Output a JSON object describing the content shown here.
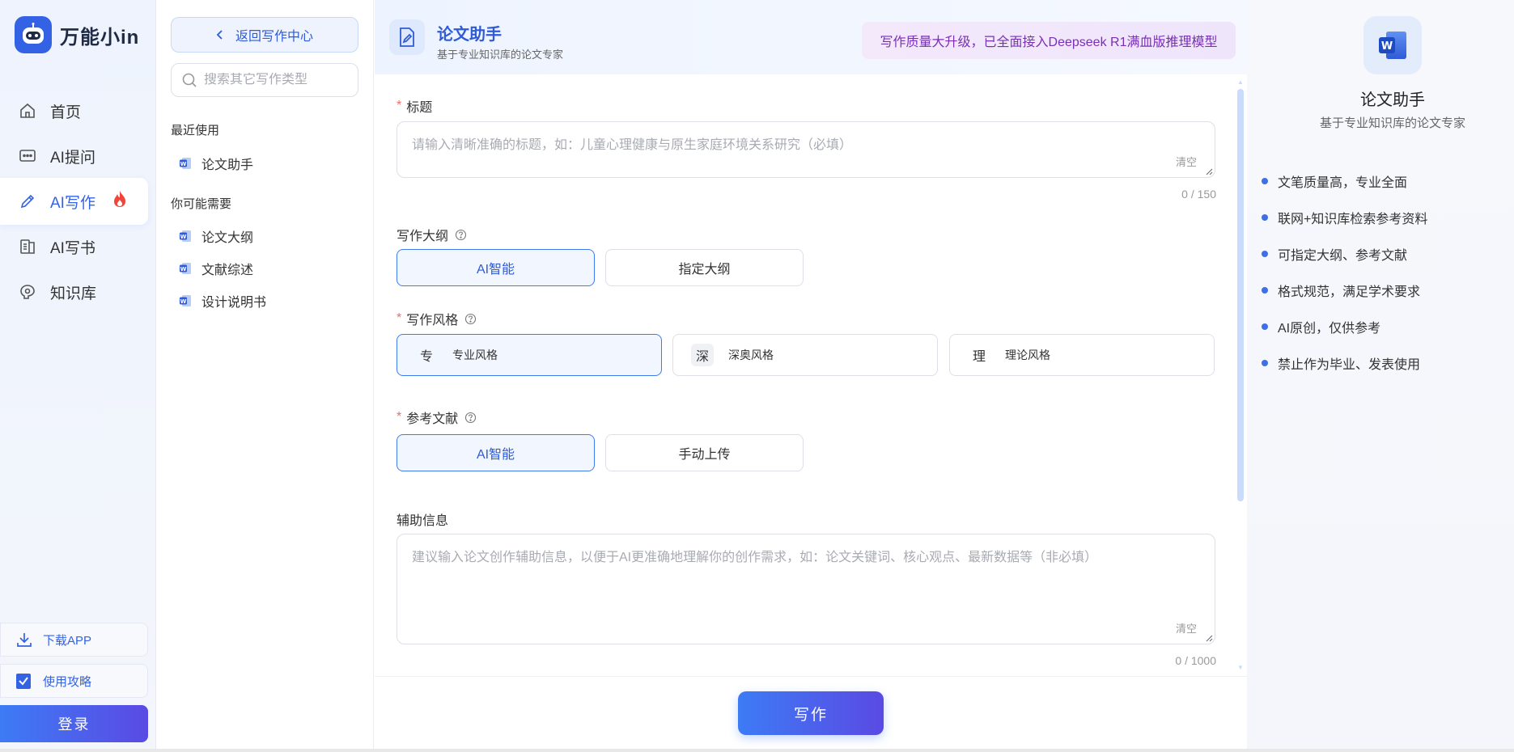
{
  "brand": {
    "name": "万能小in",
    "color": "#3462e4"
  },
  "nav": {
    "items": [
      {
        "label": "首页",
        "icon": "home-icon"
      },
      {
        "label": "AI提问",
        "icon": "chat-icon"
      },
      {
        "label": "AI写作",
        "icon": "pencil-icon",
        "active": true
      },
      {
        "label": "AI写书",
        "icon": "book-icon"
      },
      {
        "label": "知识库",
        "icon": "knowledge-icon"
      }
    ],
    "download_label": "下载APP",
    "guide_label": "使用攻略",
    "login_label": "登录"
  },
  "col2": {
    "back_label": "返回写作中心",
    "search_placeholder": "搜索其它写作类型",
    "recent_title": "最近使用",
    "recent_items": [
      "论文助手"
    ],
    "maybe_title": "你可能需要",
    "maybe_items": [
      "论文大纲",
      "文献综述",
      "设计说明书"
    ]
  },
  "header": {
    "title": "论文助手",
    "subtitle": "基于专业知识库的论文专家",
    "banner": "写作质量大升级，已全面接入Deepseek R1满血版推理模型"
  },
  "form": {
    "title_label": "标题",
    "title_placeholder": "请输入清晰准确的标题，如：儿童心理健康与原生家庭环境关系研究（必填）",
    "title_clear": "清空",
    "title_counter": "0 / 150",
    "outline_label": "写作大纲",
    "outline_options": [
      "AI智能",
      "指定大纲"
    ],
    "style_label": "写作风格",
    "style_options": [
      {
        "badge": "专",
        "label": "专业风格"
      },
      {
        "badge": "深",
        "label": "深奥风格"
      },
      {
        "badge": "理",
        "label": "理论风格"
      }
    ],
    "ref_label": "参考文献",
    "ref_options": [
      "AI智能",
      "手动上传"
    ],
    "aux_label": "辅助信息",
    "aux_placeholder": "建议输入论文创作辅助信息，以便于AI更准确地理解你的创作需求，如：论文关键词、核心观点、最新数据等（非必填）",
    "aux_clear": "清空",
    "aux_counter": "0 / 1000",
    "submit_label": "写作"
  },
  "right": {
    "title": "论文助手",
    "subtitle": "基于专业知识库的论文专家",
    "features": [
      "文笔质量高，专业全面",
      "联网+知识库检索参考资料",
      "可指定大纲、参考文献",
      "格式规范，满足学术要求",
      "AI原创，仅供参考",
      "禁止作为毕业、发表使用"
    ]
  }
}
